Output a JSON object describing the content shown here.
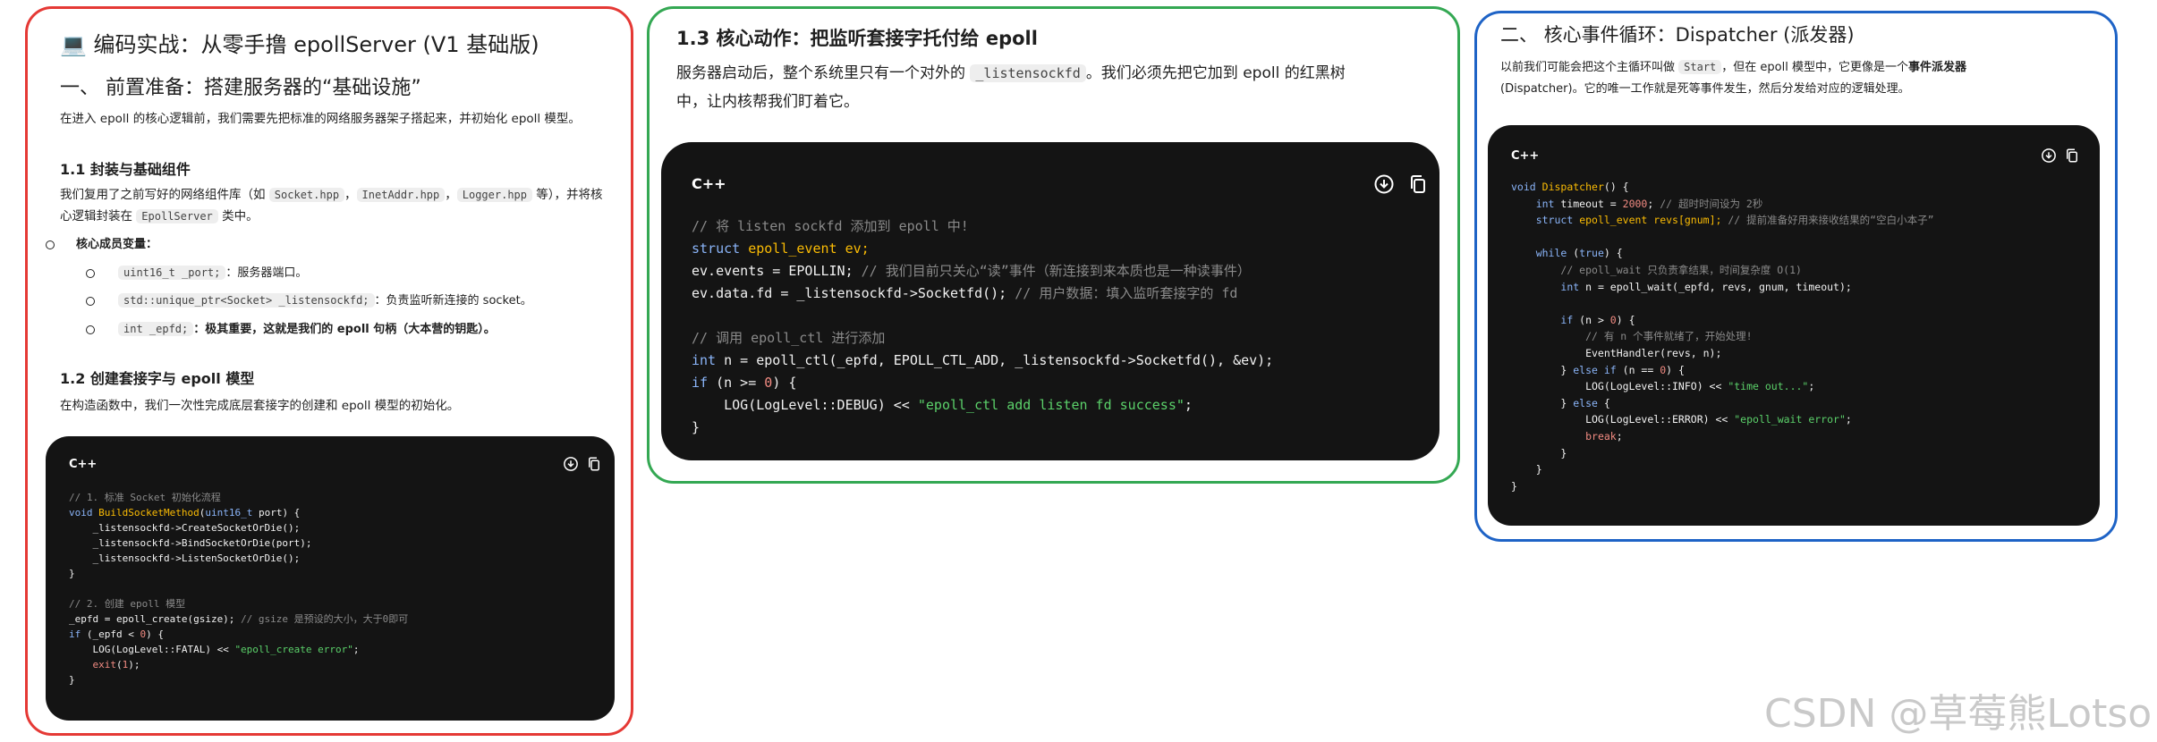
{
  "panel1": {
    "emoji": "💻",
    "title": "编码实战：从零手撸 epollServer (V1 基础版)",
    "section1_heading": "一、 前置准备：搭建服务器的“基础设施”",
    "section1_intro": "在进入 epoll 的核心逻辑前，我们需要先把标准的网络服务器架子搭起来，并初始化 epoll 模型。",
    "sub11_heading": "1.1 封装与基础组件",
    "sub11_text_pre": "我们复用了之前写好的网络组件库（如 ",
    "sub11_code1": "Socket.hpp",
    "sub11_sep1": "，",
    "sub11_code2": "InetAddr.hpp",
    "sub11_sep2": "，",
    "sub11_code3": "Logger.hpp",
    "sub11_text_mid": " 等），并将核",
    "sub11_text_line2_pre": "心逻辑封装在 ",
    "sub11_code4": "EpollServer",
    "sub11_text_line2_post": " 类中。",
    "members_label": "核心成员变量：",
    "member1_code": "uint16_t _port;",
    "member1_text": "：服务器端口。",
    "member2_code": "std::unique_ptr<Socket> _listensockfd;",
    "member2_text": "：负责监听新连接的 socket。",
    "member3_code": "int _epfd;",
    "member3_text": "：极其重要，这就是我们的 epoll 句柄（大本营的钥匙）。",
    "sub12_heading": "1.2 创建套接字与 epoll 模型",
    "sub12_text": "在构造函数中，我们一次性完成底层套接字的创建和 epoll 模型的初始化。",
    "code_lang": "C++"
  },
  "panel2": {
    "title": "1.3 核心动作：把监听套接字托付给 epoll",
    "text_pre": "服务器启动后，整个系统里只有一个对外的 ",
    "text_code": "_listensockfd",
    "text_post": "。我们必须先把它加到 epoll 的红黑树",
    "text_line2": "中，让内核帮我们盯着它。",
    "code_lang": "C++"
  },
  "panel3": {
    "title": "二、 核心事件循环：Dispatcher (派发器)",
    "text_pre": "以前我们可能会把这个主循环叫做 ",
    "text_code": "Start",
    "text_mid": "，但在 epoll 模型中，它更像是一个",
    "text_bold": "事件派发器",
    "text_line2": "(Dispatcher)。它的唯一工作就是死等事件发生，然后分发给对应的逻辑处理。",
    "code_lang": "C++"
  },
  "watermark": "CSDN @草莓熊Lotso"
}
